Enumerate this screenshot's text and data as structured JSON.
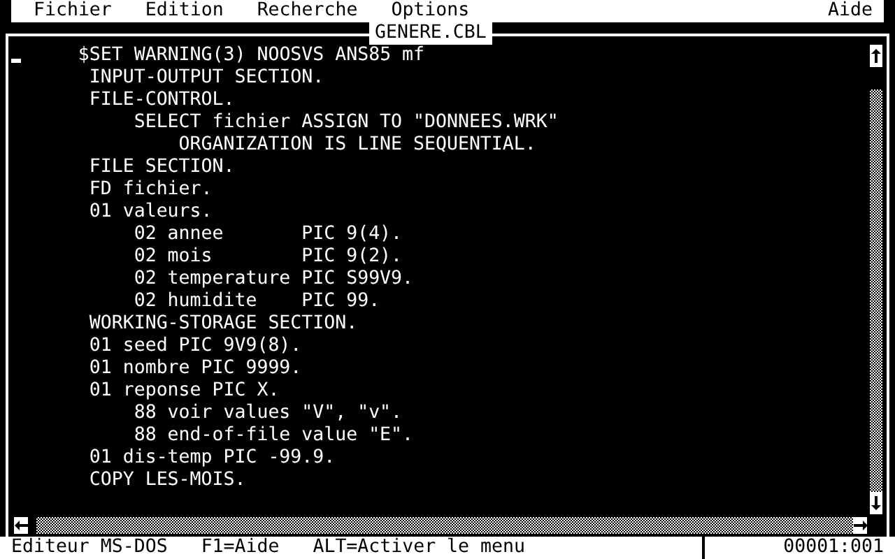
{
  "menu_bar": {
    "items": [
      "Fichier",
      "Edition",
      "Recherche",
      "Options"
    ],
    "help": "Aide"
  },
  "window": {
    "title": "GENERE.CBL"
  },
  "editor": {
    "lines": [
      "     $SET WARNING(3) NOOSVS ANS85 mf",
      "       INPUT-OUTPUT SECTION.",
      "       FILE-CONTROL.",
      "           SELECT fichier ASSIGN TO \"DONNEES.WRK\"",
      "               ORGANIZATION IS LINE SEQUENTIAL.",
      "       FILE SECTION.",
      "       FD fichier.",
      "       01 valeurs.",
      "           02 annee       PIC 9(4).",
      "           02 mois        PIC 9(2).",
      "           02 temperature PIC S99V9.",
      "           02 humidite    PIC 99.",
      "       WORKING-STORAGE SECTION.",
      "       01 seed PIC 9V9(8).",
      "       01 nombre PIC 9999.",
      "       01 reponse PIC X.",
      "           88 voir values \"V\", \"v\".",
      "           88 end-of-file value \"E\".",
      "       01 dis-temp PIC -99.9.",
      "       COPY LES-MOIS."
    ]
  },
  "status_bar": {
    "app": "Editeur MS-DOS",
    "help_hint": "F1=Aide",
    "menu_hint": "ALT=Activer le menu",
    "position": "00001:001"
  }
}
